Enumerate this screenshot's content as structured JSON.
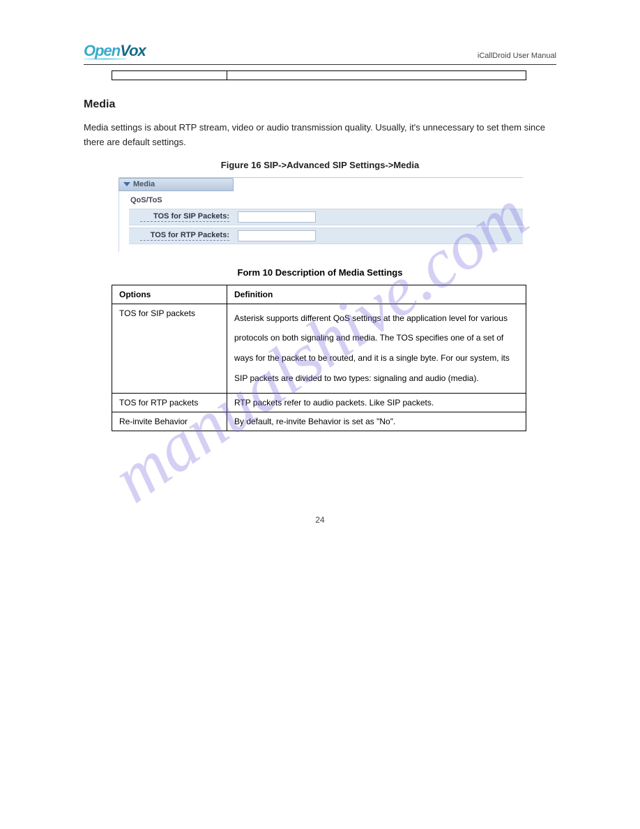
{
  "header": {
    "logo_open": "Open",
    "logo_vox": "Vox",
    "right_text": "iCallDroid User Manual"
  },
  "table1": {
    "row": {
      "opt": "",
      "def": ""
    }
  },
  "section": {
    "title": "Media",
    "text": "Media settings is about RTP stream, video or audio transmission quality. Usually, it's unnecessary to set them since there are default settings."
  },
  "figure": {
    "caption": "Figure 16 SIP->Advanced SIP Settings->Media",
    "panel_title": "Media",
    "qos": "QoS/ToS",
    "row1_label": "TOS for SIP Packets:",
    "row1_value": "",
    "row2_label": "TOS for RTP Packets:",
    "row2_value": ""
  },
  "table2": {
    "caption": "Form 10 Description of Media Settings",
    "h1": "Options",
    "h2": "Definition",
    "r1": {
      "opt": "TOS for SIP packets",
      "def": "Asterisk supports different QoS settings at the application level for various protocols on both signaling and media. The TOS specifies one of a set of ways for the packet to be routed, and it is a single byte. For our system, its SIP packets are divided to two types: signaling and audio (media)."
    },
    "r2": {
      "opt": "TOS for RTP packets",
      "def": "RTP packets refer to audio packets. Like SIP packets."
    },
    "r3": {
      "opt": "Re-invite Behavior",
      "def": "By default, re-invite Behavior is set as \"No\"."
    }
  },
  "page_number": "24"
}
